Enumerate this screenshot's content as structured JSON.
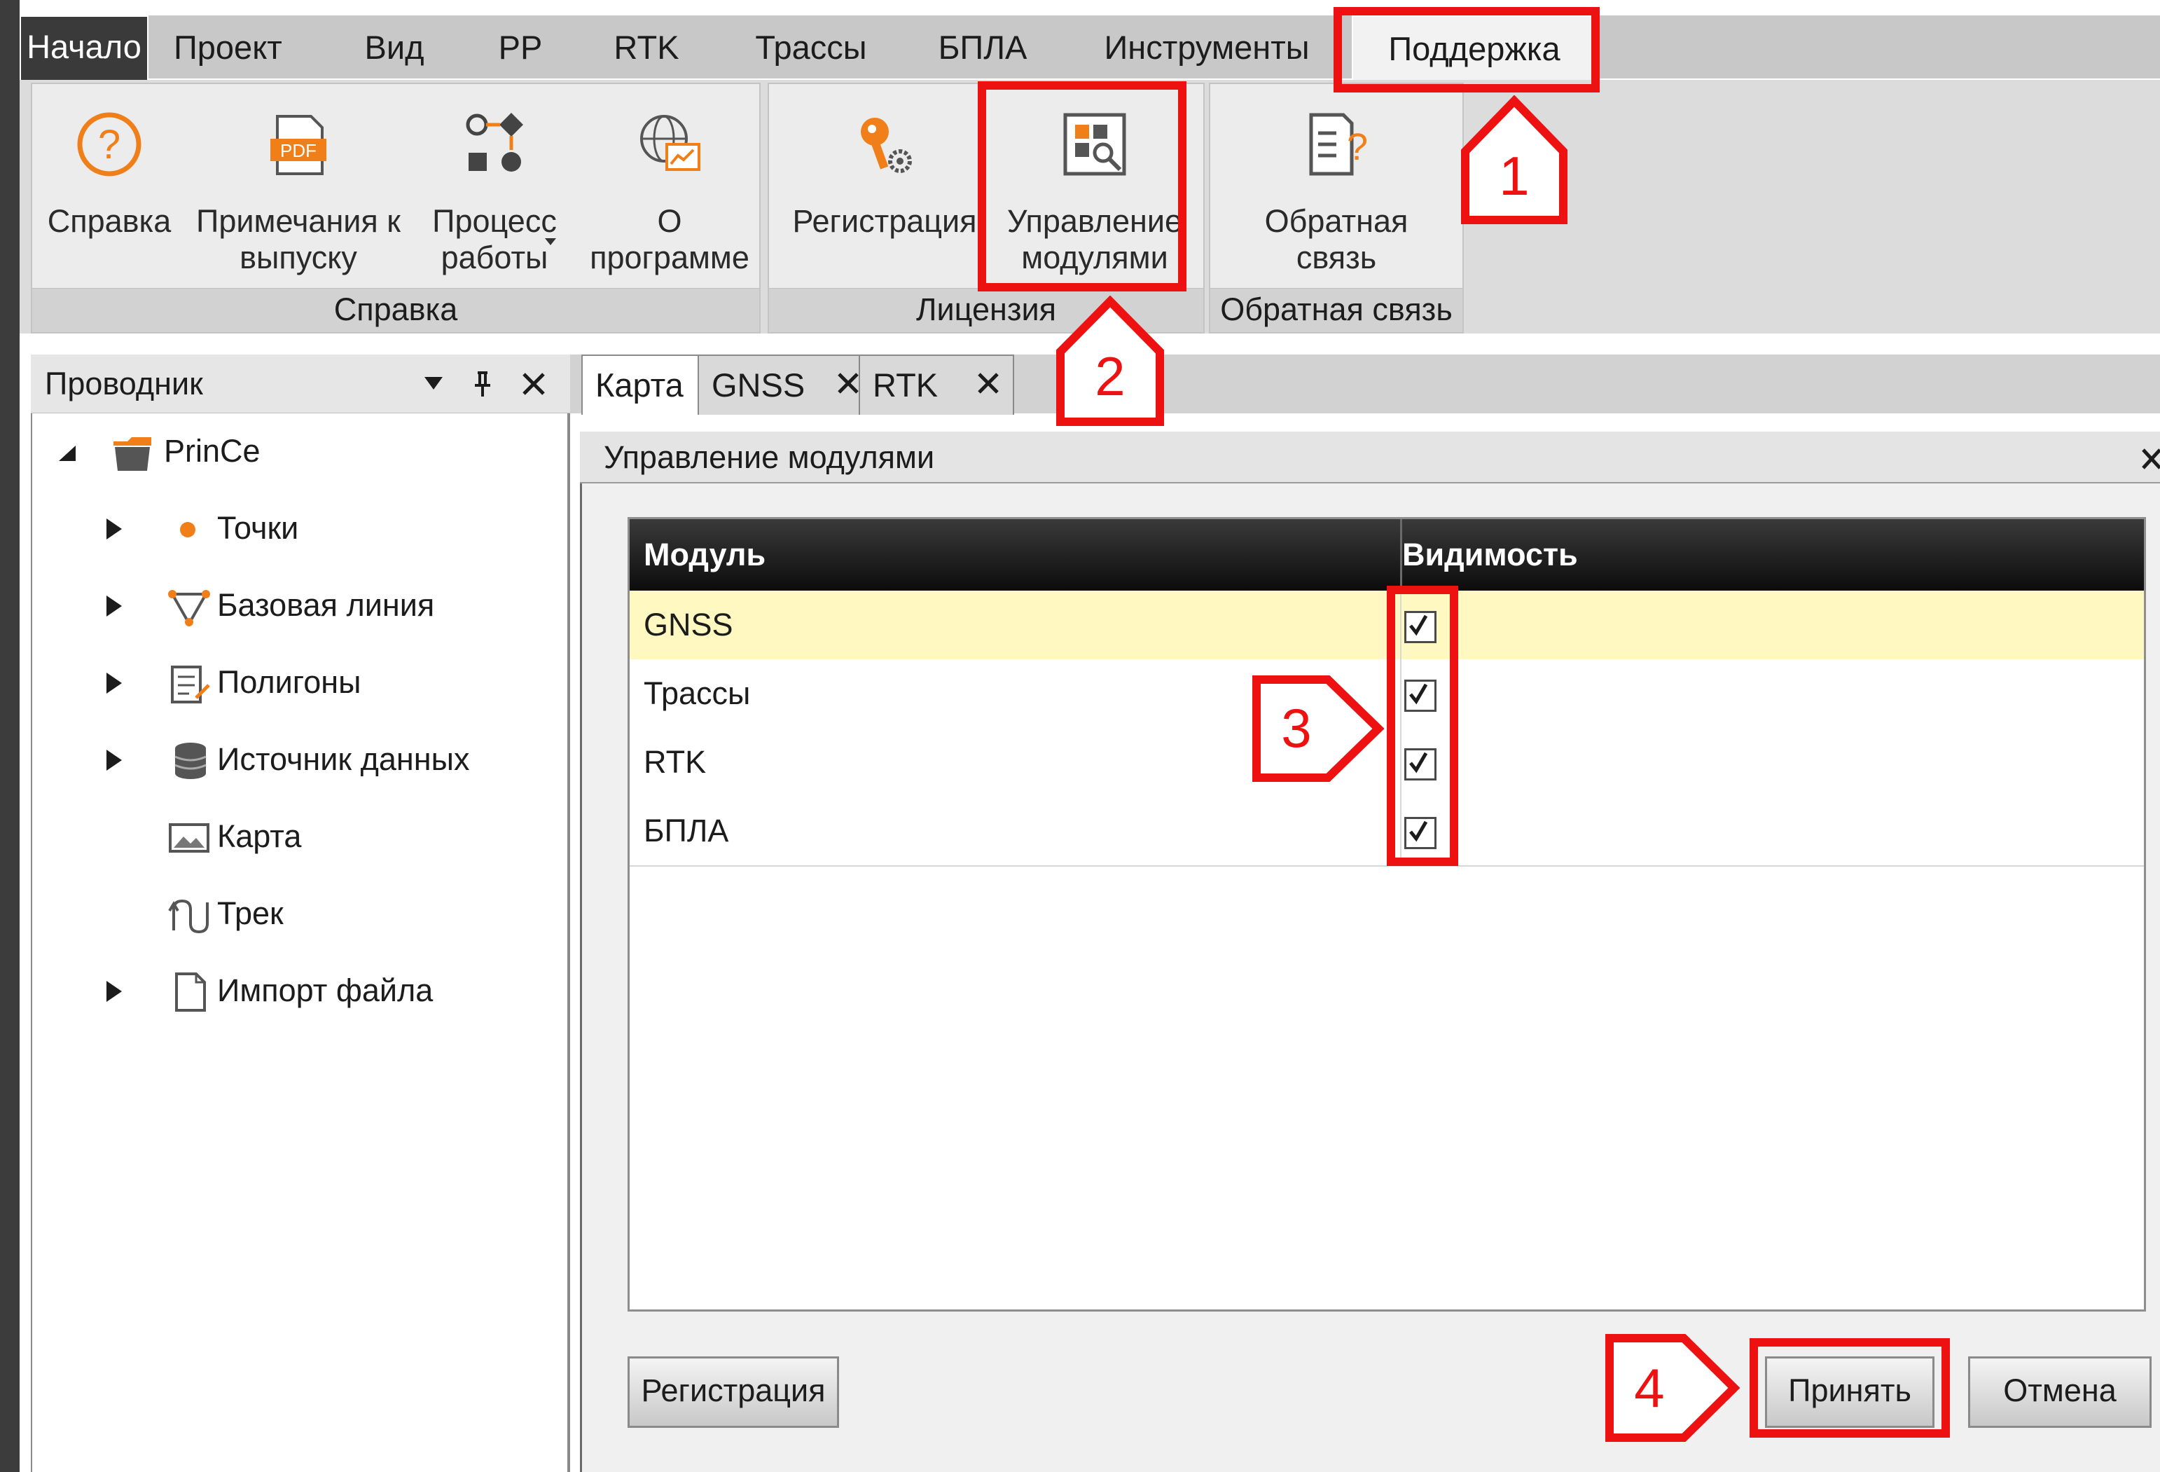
{
  "menu": {
    "tabs": [
      "Начало",
      "Проект",
      "Вид",
      "PP",
      "RTK",
      "Трассы",
      "БПЛА",
      "Инструменты",
      "Поддержка"
    ]
  },
  "ribbon": {
    "groups": [
      {
        "caption": "Справка",
        "buttons": [
          {
            "label": "Справка"
          },
          {
            "label": "Примечания к выпуску"
          },
          {
            "label": "Процесс работы"
          },
          {
            "label": "О программе"
          }
        ]
      },
      {
        "caption": "Лицензия",
        "buttons": [
          {
            "label": "Регистрация"
          },
          {
            "label": "Управление модулями"
          }
        ]
      },
      {
        "caption": "Обратная связь",
        "buttons": [
          {
            "label": "Обратная связь"
          }
        ]
      }
    ]
  },
  "explorer": {
    "title": "Проводник",
    "root": "PrinCe",
    "items": [
      "Точки",
      "Базовая линия",
      "Полигоны",
      "Источник данных",
      "Карта",
      "Трек",
      "Импорт файла"
    ]
  },
  "doc_tabs": [
    "Карта",
    "GNSS",
    "RTK"
  ],
  "dialog": {
    "title": "Управление модулями",
    "columns": [
      "Модуль",
      "Видимость"
    ],
    "rows": [
      {
        "module": "GNSS",
        "visible": true
      },
      {
        "module": "Трассы",
        "visible": true
      },
      {
        "module": "RTK",
        "visible": true
      },
      {
        "module": "БПЛА",
        "visible": true
      }
    ],
    "register_button": "Регистрация",
    "accept_button": "Принять",
    "cancel_button": "Отмена"
  },
  "annotations": [
    "1",
    "2",
    "3",
    "4"
  ],
  "colors": {
    "annotation": "#ee1111",
    "selected_row": "#fff8c0",
    "header_bg": "#1a1a1a"
  }
}
